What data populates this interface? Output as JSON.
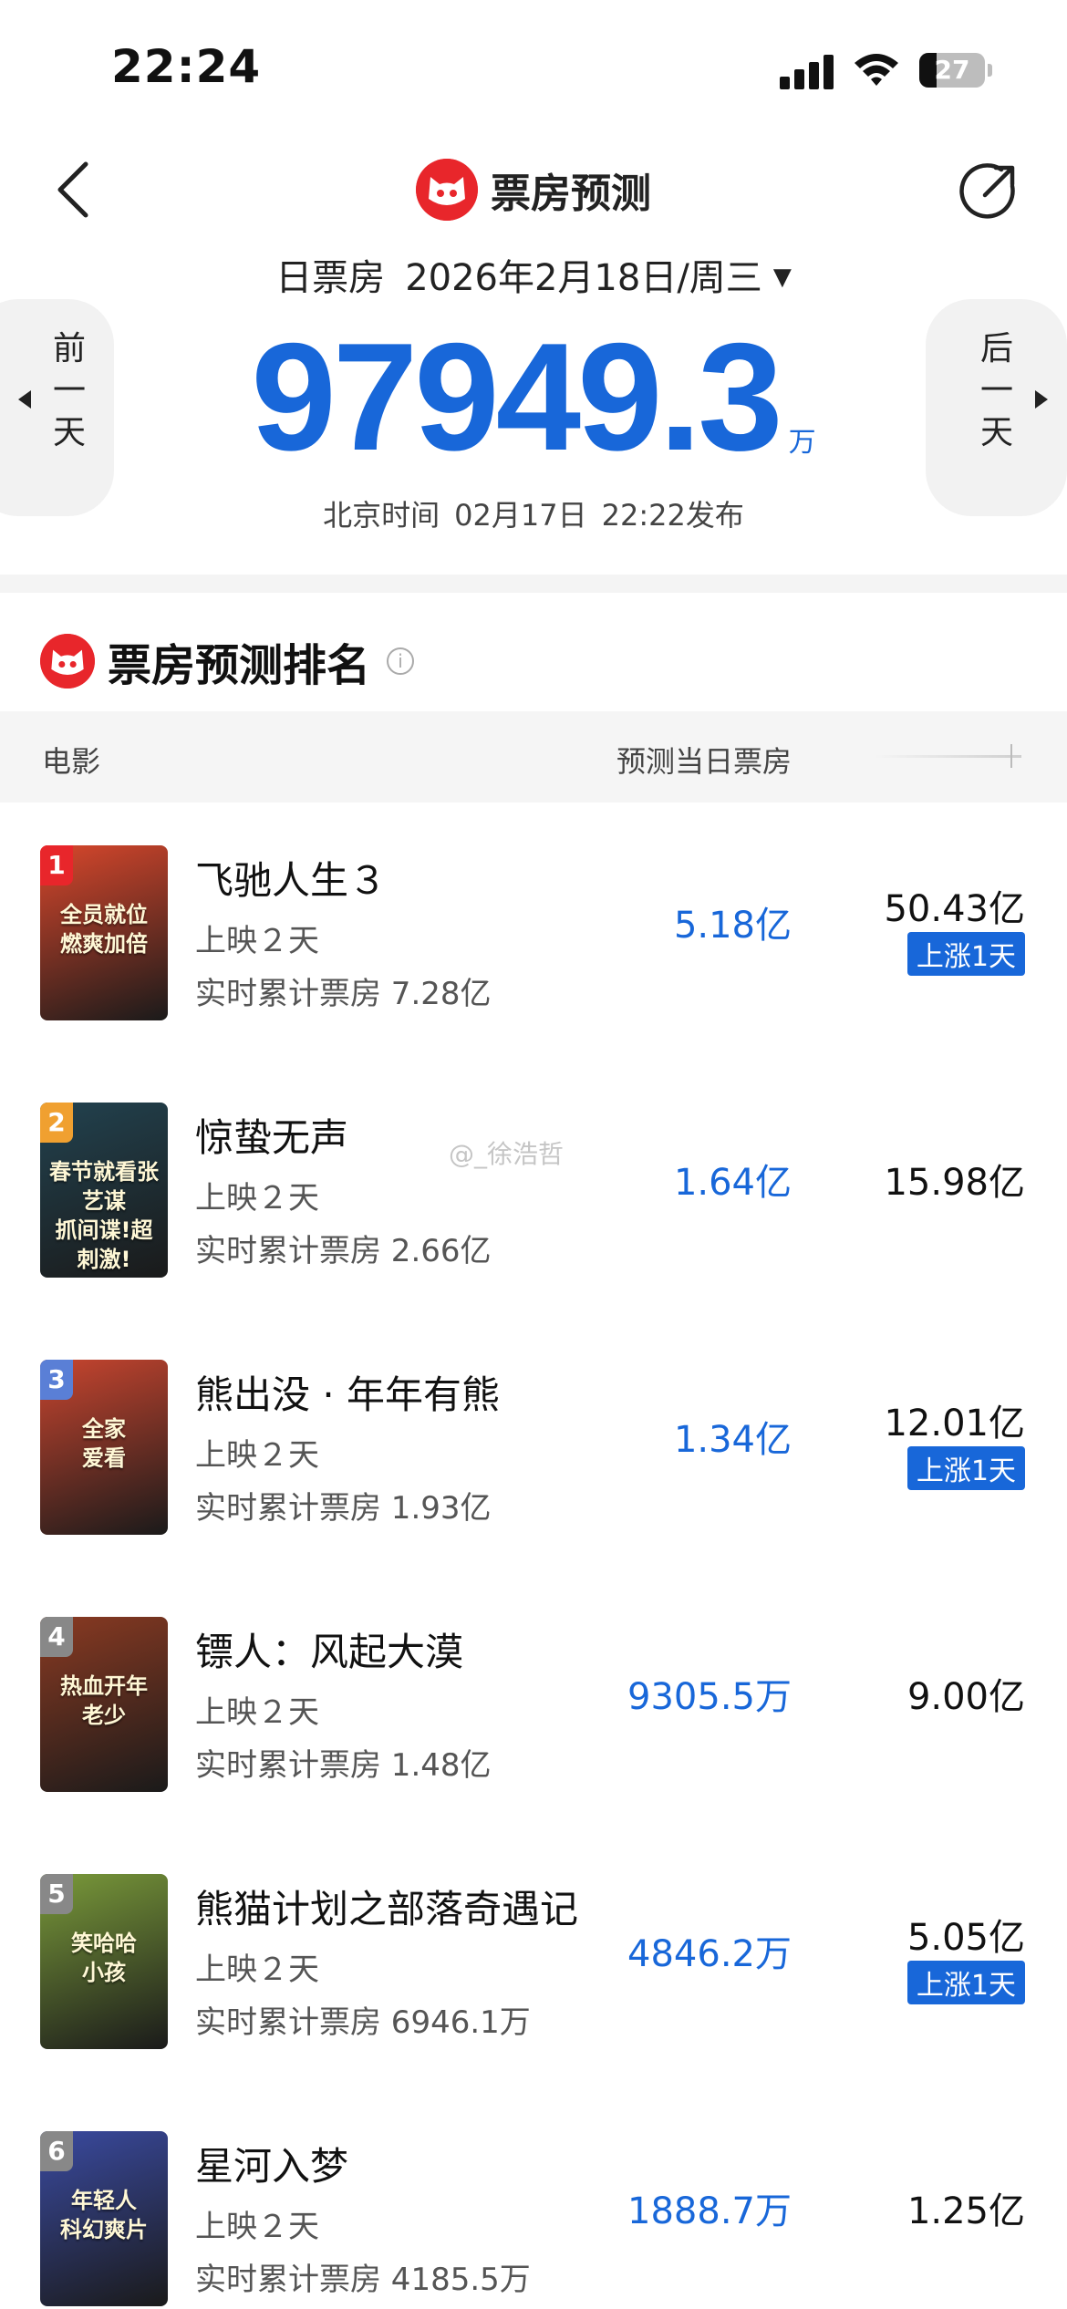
{
  "status_bar": {
    "time": "22:24",
    "battery": "27",
    "battery_level": 0.27
  },
  "header": {
    "title": "票房预测"
  },
  "date_selector": {
    "label": "日票房",
    "date": "2026年2月18日/周三",
    "caret": "▼"
  },
  "nav_buttons": {
    "prev": [
      "前",
      "一",
      "天"
    ],
    "next": [
      "后",
      "一",
      "天"
    ]
  },
  "total": {
    "value": "97949.3",
    "unit": "万"
  },
  "publish": {
    "prefix": "北京时间",
    "date": "02月17日",
    "time": "22:22发布"
  },
  "section": {
    "title": "票房预测排名",
    "info": "i"
  },
  "columns": {
    "movie": "电影",
    "forecast": "预测当日票房"
  },
  "watermark": "@_徐浩哲",
  "colors": {
    "accent": "#1867d9",
    "brand_red": "#e8262b"
  },
  "movies": [
    {
      "rank": "1",
      "name": "飞驰人生３",
      "days": "上映２天",
      "cumulative": "实时累计票房 7.28亿",
      "forecast": "5.18亿",
      "total": "50.43亿",
      "badge": "上涨1天",
      "poster_text": "全员就位\n燃爽加倍",
      "rank_color": "#e8262b",
      "poster_bg": "#d8472c"
    },
    {
      "rank": "2",
      "name": "惊蛰无声",
      "days": "上映２天",
      "cumulative": "实时累计票房 2.66亿",
      "forecast": "1.64亿",
      "total": "15.98亿",
      "badge": "",
      "poster_text": "春节就看张艺谋\n抓间谍!超刺激!",
      "rank_color": "#f0a030",
      "poster_bg": "#22424f"
    },
    {
      "rank": "3",
      "name": "熊出没 · 年年有熊",
      "days": "上映２天",
      "cumulative": "实时累计票房 1.93亿",
      "forecast": "1.34亿",
      "total": "12.01亿",
      "badge": "上涨1天",
      "poster_text": "全家\n爱看",
      "rank_color": "#5a7fd6",
      "poster_bg": "#c8452f"
    },
    {
      "rank": "4",
      "name": "镖人：风起大漠",
      "days": "上映２天",
      "cumulative": "实时累计票房 1.48亿",
      "forecast": "9305.5万",
      "total": "9.00亿",
      "badge": "",
      "poster_text": "热血开年\n老少",
      "rank_color": "#888888",
      "poster_bg": "#8a3a22"
    },
    {
      "rank": "5",
      "name": "熊猫计划之部落奇遇记",
      "days": "上映２天",
      "cumulative": "实时累计票房 6946.1万",
      "forecast": "4846.2万",
      "total": "5.05亿",
      "badge": "上涨1天",
      "poster_text": "笑哈哈\n小孩",
      "rank_color": "#888888",
      "poster_bg": "#7a9a3a"
    },
    {
      "rank": "6",
      "name": "星河入梦",
      "days": "上映２天",
      "cumulative": "实时累计票房 4185.5万",
      "forecast": "1888.7万",
      "total": "1.25亿",
      "badge": "",
      "poster_text": "年轻人\n科幻爽片",
      "rank_color": "#888888",
      "poster_bg": "#3a4aa0"
    }
  ]
}
